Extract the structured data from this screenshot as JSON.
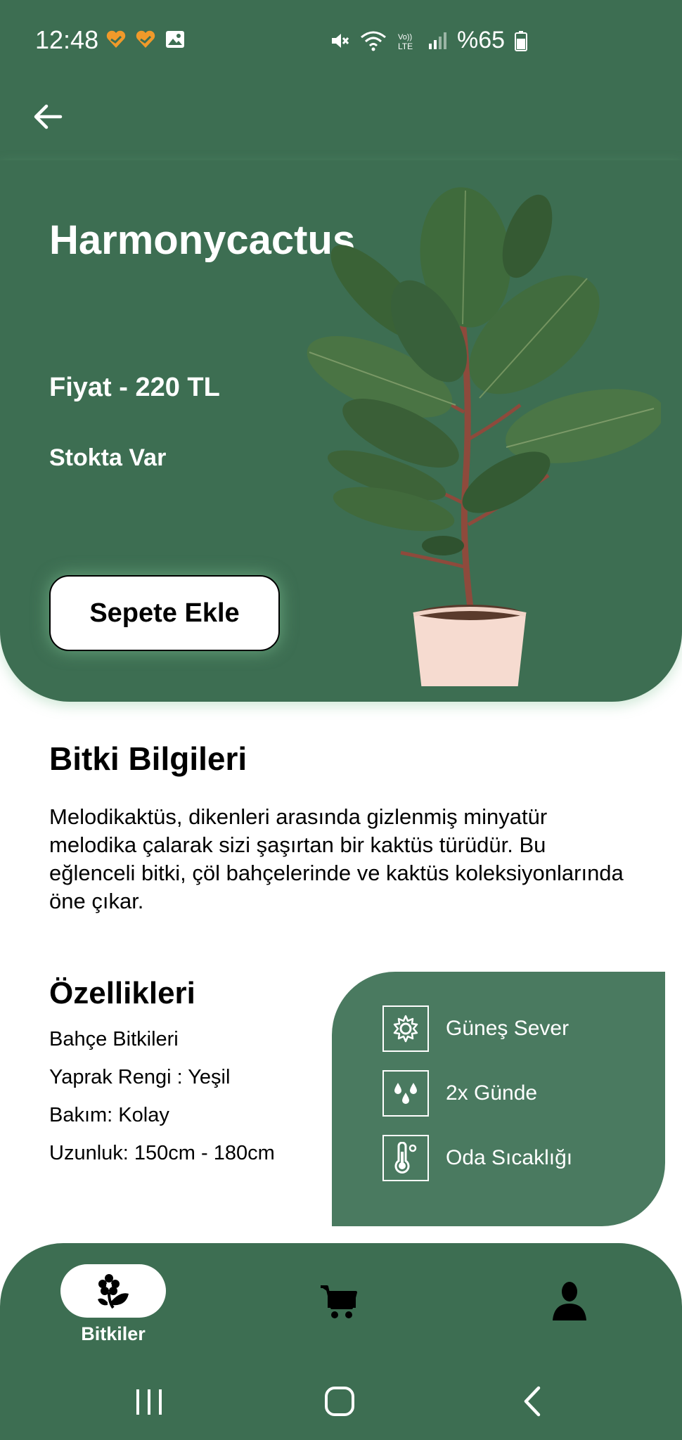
{
  "status_bar": {
    "time": "12:48",
    "battery": "%65",
    "network": "LTE"
  },
  "app_bar": {
    "back_icon": "arrow-left-icon"
  },
  "hero": {
    "title": "Harmonycactus",
    "price": "Fiyat - 220 TL",
    "stock": "Stokta Var",
    "add_to_cart": "Sepete Ekle"
  },
  "info": {
    "title": "Bitki Bilgileri",
    "description": "Melodikaktüs, dikenleri arasında gizlenmiş minyatür melodika çalarak sizi şaşırtan bir kaktüs türüdür. Bu eğlenceli bitki, çöl bahçelerinde ve kaktüs koleksiyonlarında öne çıkar."
  },
  "features": {
    "title": "Özellikleri",
    "items": [
      "Bahçe Bitkileri",
      "Yaprak Rengi : Yeşil",
      "Bakım: Kolay",
      "Uzunluk: 150cm - 180cm"
    ]
  },
  "care": {
    "items": [
      {
        "icon": "sun-icon",
        "label": "Güneş Sever"
      },
      {
        "icon": "water-drops-icon",
        "label": "2x Günde"
      },
      {
        "icon": "thermometer-icon",
        "label": "Oda Sıcaklığı"
      }
    ]
  },
  "bottom_nav": {
    "items": [
      {
        "icon": "plant-icon",
        "label": "Bitkiler",
        "active": true
      },
      {
        "icon": "cart-icon",
        "label": "",
        "active": false
      },
      {
        "icon": "profile-icon",
        "label": "",
        "active": false
      }
    ]
  },
  "colors": {
    "primary": "#3d6e52",
    "card": "#4a7a60",
    "white": "#ffffff"
  }
}
